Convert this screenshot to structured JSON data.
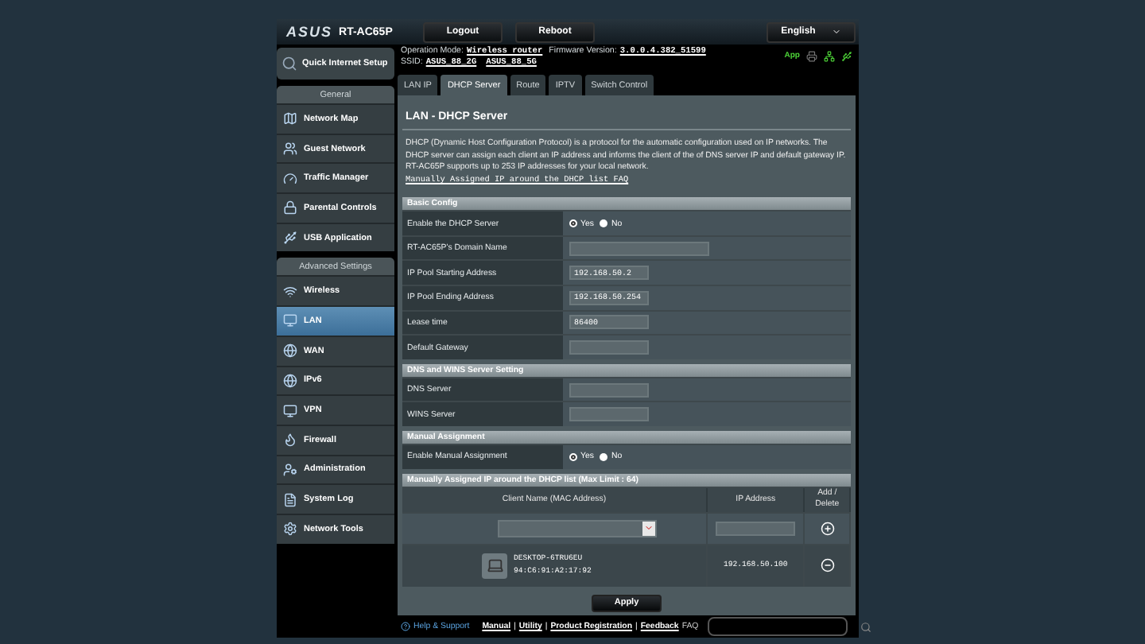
{
  "header": {
    "logo": "ASUS",
    "model": "RT-AC65P",
    "buttons": [
      "Logout",
      "Reboot"
    ],
    "language": "English"
  },
  "info": {
    "operation_mode_label": "Operation Mode:",
    "operation_mode": "Wireless router",
    "firmware_label": "Firmware Version:",
    "firmware": "3.0.0.4.382_51599",
    "ssid_label": "SSID:",
    "ssids": [
      "ASUS_88_2G",
      "ASUS_88_5G"
    ],
    "app": "App"
  },
  "sidebar": {
    "quick_setup": "Quick Internet Setup",
    "sections": [
      {
        "title": "General",
        "items": [
          {
            "label": "Network Map",
            "selected": false
          },
          {
            "label": "Guest Network",
            "selected": false
          },
          {
            "label": "Traffic Manager",
            "selected": false
          },
          {
            "label": "Parental Controls",
            "selected": false
          },
          {
            "label": "USB Application",
            "selected": false
          }
        ]
      },
      {
        "title": "Advanced Settings",
        "items": [
          {
            "label": "Wireless",
            "selected": false
          },
          {
            "label": "LAN",
            "selected": true
          },
          {
            "label": "WAN",
            "selected": false
          },
          {
            "label": "IPv6",
            "selected": false
          },
          {
            "label": "VPN",
            "selected": false
          },
          {
            "label": "Firewall",
            "selected": false
          },
          {
            "label": "Administration",
            "selected": false
          },
          {
            "label": "System Log",
            "selected": false
          },
          {
            "label": "Network Tools",
            "selected": false
          }
        ]
      }
    ]
  },
  "tabs": [
    {
      "label": "LAN IP",
      "selected": false
    },
    {
      "label": "DHCP Server",
      "selected": true
    },
    {
      "label": "Route",
      "selected": false
    },
    {
      "label": "IPTV",
      "selected": false
    },
    {
      "label": "Switch Control",
      "selected": false
    }
  ],
  "page": {
    "title": "LAN - DHCP Server",
    "description": "DHCP (Dynamic Host Configuration Protocol) is a protocol for the automatic configuration used on IP networks. The DHCP server can assign each client an IP address and informs the client of the of DNS server IP and default gateway IP. RT-AC65P supports up to 253 IP addresses for your local network.",
    "faq_link": "Manually Assigned IP around the DHCP list FAQ",
    "sections": [
      {
        "title": "Basic Config",
        "rows": [
          {
            "label": "Enable the DHCP Server",
            "kind": "radio",
            "options": [
              {
                "label": "Yes",
                "selected": true
              },
              {
                "label": "No",
                "selected": false
              }
            ]
          },
          {
            "label": "RT-AC65P's Domain Name",
            "kind": "text",
            "wide": true
          },
          {
            "label": "IP Pool Starting Address",
            "kind": "text",
            "value": "192.168.50.2"
          },
          {
            "label": "IP Pool Ending Address",
            "kind": "text",
            "value": "192.168.50.254"
          },
          {
            "label": "Lease time",
            "kind": "text",
            "value": "86400"
          },
          {
            "label": "Default Gateway",
            "kind": "text"
          }
        ]
      },
      {
        "title": "DNS and WINS Server Setting",
        "rows": [
          {
            "label": "DNS Server",
            "kind": "text"
          },
          {
            "label": "WINS Server",
            "kind": "text"
          }
        ]
      },
      {
        "title": "Manual Assignment",
        "rows": [
          {
            "label": "Enable Manual Assignment",
            "kind": "radio",
            "options": [
              {
                "label": "Yes",
                "selected": true
              },
              {
                "label": "No",
                "selected": false
              }
            ]
          }
        ]
      }
    ],
    "list": {
      "title": "Manually Assigned IP around the DHCP list (Max Limit : 64)",
      "columns": [
        "Client Name (MAC Address)",
        "IP Address",
        "Add / Delete"
      ],
      "clients": [
        {
          "name": "DESKTOP-6TRU6EU",
          "mac": "94:C6:91:A2:17:92",
          "ip": "192.168.50.100"
        }
      ]
    },
    "apply": "Apply"
  },
  "footer": {
    "help": "Help & Support",
    "links": [
      "Manual",
      "Utility",
      "Product Registration",
      "Feedback"
    ],
    "separator": "|",
    "faq": "FAQ"
  }
}
